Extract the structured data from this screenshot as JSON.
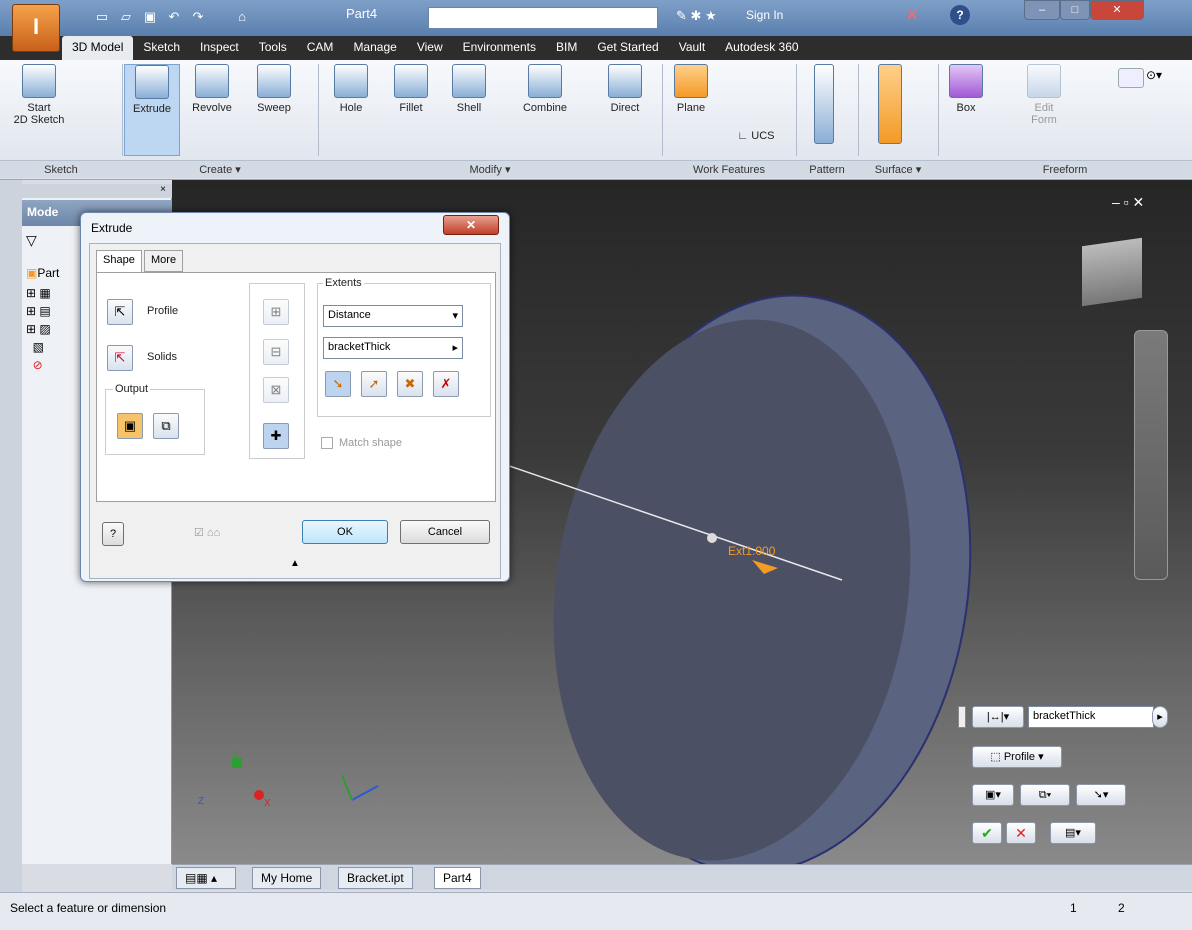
{
  "titlebar": {
    "doc_title": "Part4",
    "signin": "Sign In",
    "search_placeholder": ""
  },
  "quick_access": [
    "new",
    "open",
    "save",
    "undo",
    "redo",
    "home"
  ],
  "tabs": [
    "3D Model",
    "Sketch",
    "Inspect",
    "Tools",
    "CAM",
    "Manage",
    "View",
    "Environments",
    "BIM",
    "Get Started",
    "Vault",
    "Autodesk 360"
  ],
  "ribbon": {
    "start_sketch": "Start\n2D Sketch",
    "extrude": "Extrude",
    "revolve": "Revolve",
    "sweep": "Sweep",
    "hole": "Hole",
    "fillet": "Fillet",
    "shell": "Shell",
    "combine": "Combine",
    "direct": "Direct",
    "plane": "Plane",
    "ucs": "UCS",
    "box": "Box",
    "edit_form": "Edit\nForm",
    "panels": {
      "sketch": "Sketch",
      "create": "Create ▾",
      "modify": "Modify ▾",
      "work_features": "Work Features",
      "pattern": "Pattern",
      "surface": "Surface ▾",
      "freeform": "Freeform"
    }
  },
  "browser": {
    "title": "Mode",
    "root": "Part"
  },
  "dialog": {
    "title": "Extrude",
    "tab_shape": "Shape",
    "tab_more": "More",
    "profile": "Profile",
    "solids": "Solids",
    "output": "Output",
    "extents": "Extents",
    "extent_type": "Distance",
    "distance_value": "bracketThick",
    "match_shape": "Match shape",
    "ok": "OK",
    "cancel": "Cancel",
    "help": "?"
  },
  "viewport": {
    "dimension_value": "Ext1.000",
    "axes": {
      "x": "X",
      "y": "Y",
      "z": "Z"
    }
  },
  "minitoolbar": {
    "value": "bracketThick",
    "profile": "Profile"
  },
  "doc_tabs": [
    "My Home",
    "Bracket.ipt",
    "Part4"
  ],
  "status": {
    "message": "Select a feature or dimension",
    "n1": "1",
    "n2": "2"
  },
  "colors": {
    "accent": "#f39a27",
    "ribbon_bg": "#e4e9f0",
    "viewport_top": "#262626",
    "disk": "#5f6886"
  }
}
